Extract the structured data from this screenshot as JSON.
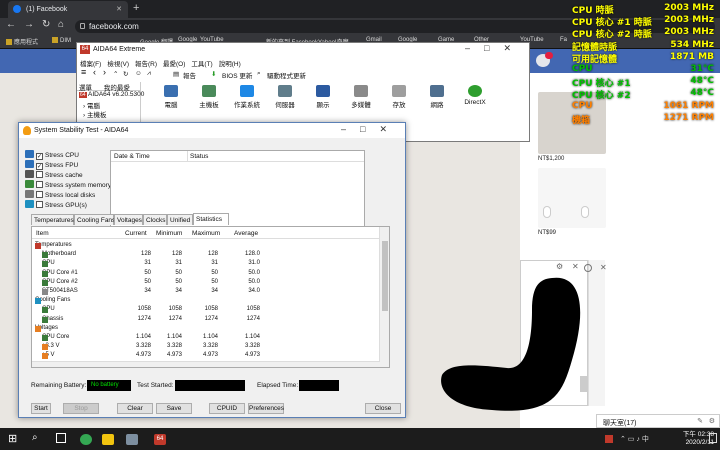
{
  "browser": {
    "tab_title": "(1) Facebook",
    "url": "facebook.com",
    "bookmarks": [
      "應用程式",
      "DIM",
      "Google 翻譯",
      "Google",
      "YouTube",
      "新的來到 Facebook",
      "Yahoo!奇摩",
      "Gmail",
      "Google",
      "Game",
      "Other",
      "YouTube",
      "Fa"
    ]
  },
  "osd": {
    "rows": [
      {
        "label": "CPU 時脈",
        "value": "2003 MHz",
        "color": "#ffff00"
      },
      {
        "label": "CPU 核心 #1 時脈",
        "value": "2003 MHz",
        "color": "#ffff00"
      },
      {
        "label": "CPU 核心 #2 時脈",
        "value": "2003 MHz",
        "color": "#ffff00"
      },
      {
        "label": "記憶體時脈",
        "value": "534 MHz",
        "color": "#ffff00"
      },
      {
        "label": "可用記憶體",
        "value": "1871 MB",
        "color": "#ffff00"
      },
      {
        "label": "CPU",
        "value": "31°C",
        "color": "#00c000"
      },
      {
        "label": "CPU 核心 #1",
        "value": "48°C",
        "color": "#00c000"
      },
      {
        "label": "CPU 核心 #2",
        "value": "48°C",
        "color": "#00c000"
      },
      {
        "label": "CPU",
        "value": "1061 RPM",
        "color": "#ff8000"
      },
      {
        "label": "機箱",
        "value": "1271 RPM",
        "color": "#ff8000"
      }
    ]
  },
  "facebook": {
    "price1": "NT$1,200",
    "price2": "NT$99",
    "chat_label": "聊天室(17)"
  },
  "aida": {
    "title": "AIDA64 Extreme",
    "menu": [
      "檔案(F)",
      "檢視(V)",
      "報告(R)",
      "最愛(O)",
      "工具(T)",
      "說明(H)"
    ],
    "toolbar": {
      "report": "報告",
      "bios": "BIOS 更新",
      "driver": "驅動程式更新"
    },
    "left_tabs": [
      "選單",
      "我的最愛"
    ],
    "tree_root": "AIDA64 v6.20.5300",
    "tree_items": [
      "電腦",
      "主機板"
    ],
    "icons": [
      "電腦",
      "主機板",
      "作業系統",
      "伺服器",
      "顯示",
      "多媒體",
      "存放",
      "網路",
      "DirectX"
    ]
  },
  "stability": {
    "title": "System Stability Test - AIDA64",
    "checks": [
      {
        "label": "Stress CPU",
        "checked": true,
        "color": "#2d6fb8"
      },
      {
        "label": "Stress FPU",
        "checked": true,
        "color": "#2d6fb8"
      },
      {
        "label": "Stress cache",
        "checked": false,
        "color": "#555"
      },
      {
        "label": "Stress system memory",
        "checked": false,
        "color": "#3a8a3a"
      },
      {
        "label": "Stress local disks",
        "checked": false,
        "color": "#777"
      },
      {
        "label": "Stress GPU(s)",
        "checked": false,
        "color": "#1e90c0"
      }
    ],
    "log_headers": {
      "date": "Date & Time",
      "status": "Status"
    },
    "tabs": [
      "Temperatures",
      "Cooling Fans",
      "Voltages",
      "Clocks",
      "Unified",
      "Statistics"
    ],
    "grid_headers": {
      "item": "Item",
      "current": "Current",
      "min": "Minimum",
      "max": "Maximum",
      "avg": "Average"
    },
    "rows": [
      {
        "type": "group",
        "item": "Temperatures",
        "color": "#c0392b"
      },
      {
        "type": "data",
        "item": "Motherboard",
        "current": "128",
        "min": "128",
        "max": "128",
        "avg": "128.0",
        "color": "#3a7a3a"
      },
      {
        "type": "data",
        "item": "CPU",
        "current": "31",
        "min": "31",
        "max": "31",
        "avg": "31.0",
        "color": "#3a7a3a"
      },
      {
        "type": "data",
        "item": "CPU Core #1",
        "current": "50",
        "min": "50",
        "max": "50",
        "avg": "50.0",
        "color": "#3a7a3a"
      },
      {
        "type": "data",
        "item": "CPU Core #2",
        "current": "50",
        "min": "50",
        "max": "50",
        "avg": "50.0",
        "color": "#3a7a3a"
      },
      {
        "type": "data",
        "item": "ST500418AS",
        "current": "34",
        "min": "34",
        "max": "34",
        "avg": "34.0",
        "color": "#888"
      },
      {
        "type": "group",
        "item": "Cooling Fans",
        "color": "#1e90c0"
      },
      {
        "type": "data",
        "item": "CPU",
        "current": "1058",
        "min": "1058",
        "max": "1058",
        "avg": "1058",
        "color": "#3a7a3a"
      },
      {
        "type": "data",
        "item": "Chassis",
        "current": "1274",
        "min": "1274",
        "max": "1274",
        "avg": "1274",
        "color": "#3a7a3a"
      },
      {
        "type": "group",
        "item": "Voltages",
        "color": "#e67e22"
      },
      {
        "type": "data",
        "item": "CPU Core",
        "current": "1.104",
        "min": "1.104",
        "max": "1.104",
        "avg": "1.104",
        "color": "#3a7a3a"
      },
      {
        "type": "data",
        "item": "+3.3 V",
        "current": "3.328",
        "min": "3.328",
        "max": "3.328",
        "avg": "3.328",
        "color": "#e67e22"
      },
      {
        "type": "data",
        "item": "+5 V",
        "current": "4.973",
        "min": "4.973",
        "max": "4.973",
        "avg": "4.973",
        "color": "#e67e22"
      },
      {
        "type": "data",
        "item": "",
        "current": "",
        "min": "",
        "max": "4.973",
        "avg": "4.973",
        "color": "#e67e22"
      }
    ],
    "remaining_battery_label": "Remaining Battery:",
    "battery_value": "No battery",
    "test_started_label": "Test Started:",
    "elapsed_label": "Elapsed Time:",
    "buttons": {
      "start": "Start",
      "stop": "Stop",
      "clear": "Clear",
      "save": "Save",
      "cpuid": "CPUID",
      "preferences": "Preferences",
      "close": "Close"
    }
  },
  "taskbar": {
    "time": "下午 02:38",
    "date": "2020/2/11"
  }
}
